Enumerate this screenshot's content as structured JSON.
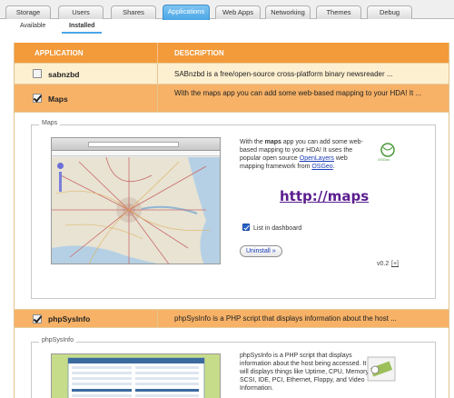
{
  "tabs": [
    {
      "label": "Storage"
    },
    {
      "label": "Users"
    },
    {
      "label": "Shares"
    },
    {
      "label": "Applications"
    },
    {
      "label": "Web Apps"
    },
    {
      "label": "Networking"
    },
    {
      "label": "Themes"
    },
    {
      "label": "Debug"
    }
  ],
  "subtabs": {
    "available": "Available",
    "installed": "Installed"
  },
  "table": {
    "col_application": "APPLICATION",
    "col_description": "DESCRIPTION"
  },
  "rows": [
    {
      "name": "sabnzbd",
      "description": "SABnzbd is a free/open-source cross-platform binary newsreader ..."
    },
    {
      "name": "Maps",
      "description": "With the maps app you can add some web-based mapping to your HDA! It ..."
    },
    {
      "name": "phpSysInfo",
      "description": "phpSysInfo is a PHP script that displays information about the host ..."
    }
  ],
  "maps_panel": {
    "legend": "Maps",
    "text_pre": "With the ",
    "text_bold": "maps",
    "text_mid": " app you can add some web-based mapping to your HDA! It uses the popular open source ",
    "link_openlayers": "OpenLayers",
    "text_mid2": " web mapping framework from ",
    "link_osgeo": "OSGeo",
    "text_end": ".",
    "url": "http://maps",
    "list_label": "List in dashboard",
    "uninstall": "Uninstall »",
    "version": "v0.2",
    "version_more": "[+]",
    "osgeo_logo": "OSGeo"
  },
  "phpsysinfo_panel": {
    "legend": "phpSysInfo",
    "text": "phpSysInfo is a PHP script that displays information about the host being accessed. It will displays things like Uptime, CPU, Memory, SCSI, IDE, PCI, Ethernet, Floppy, and Video Information."
  }
}
